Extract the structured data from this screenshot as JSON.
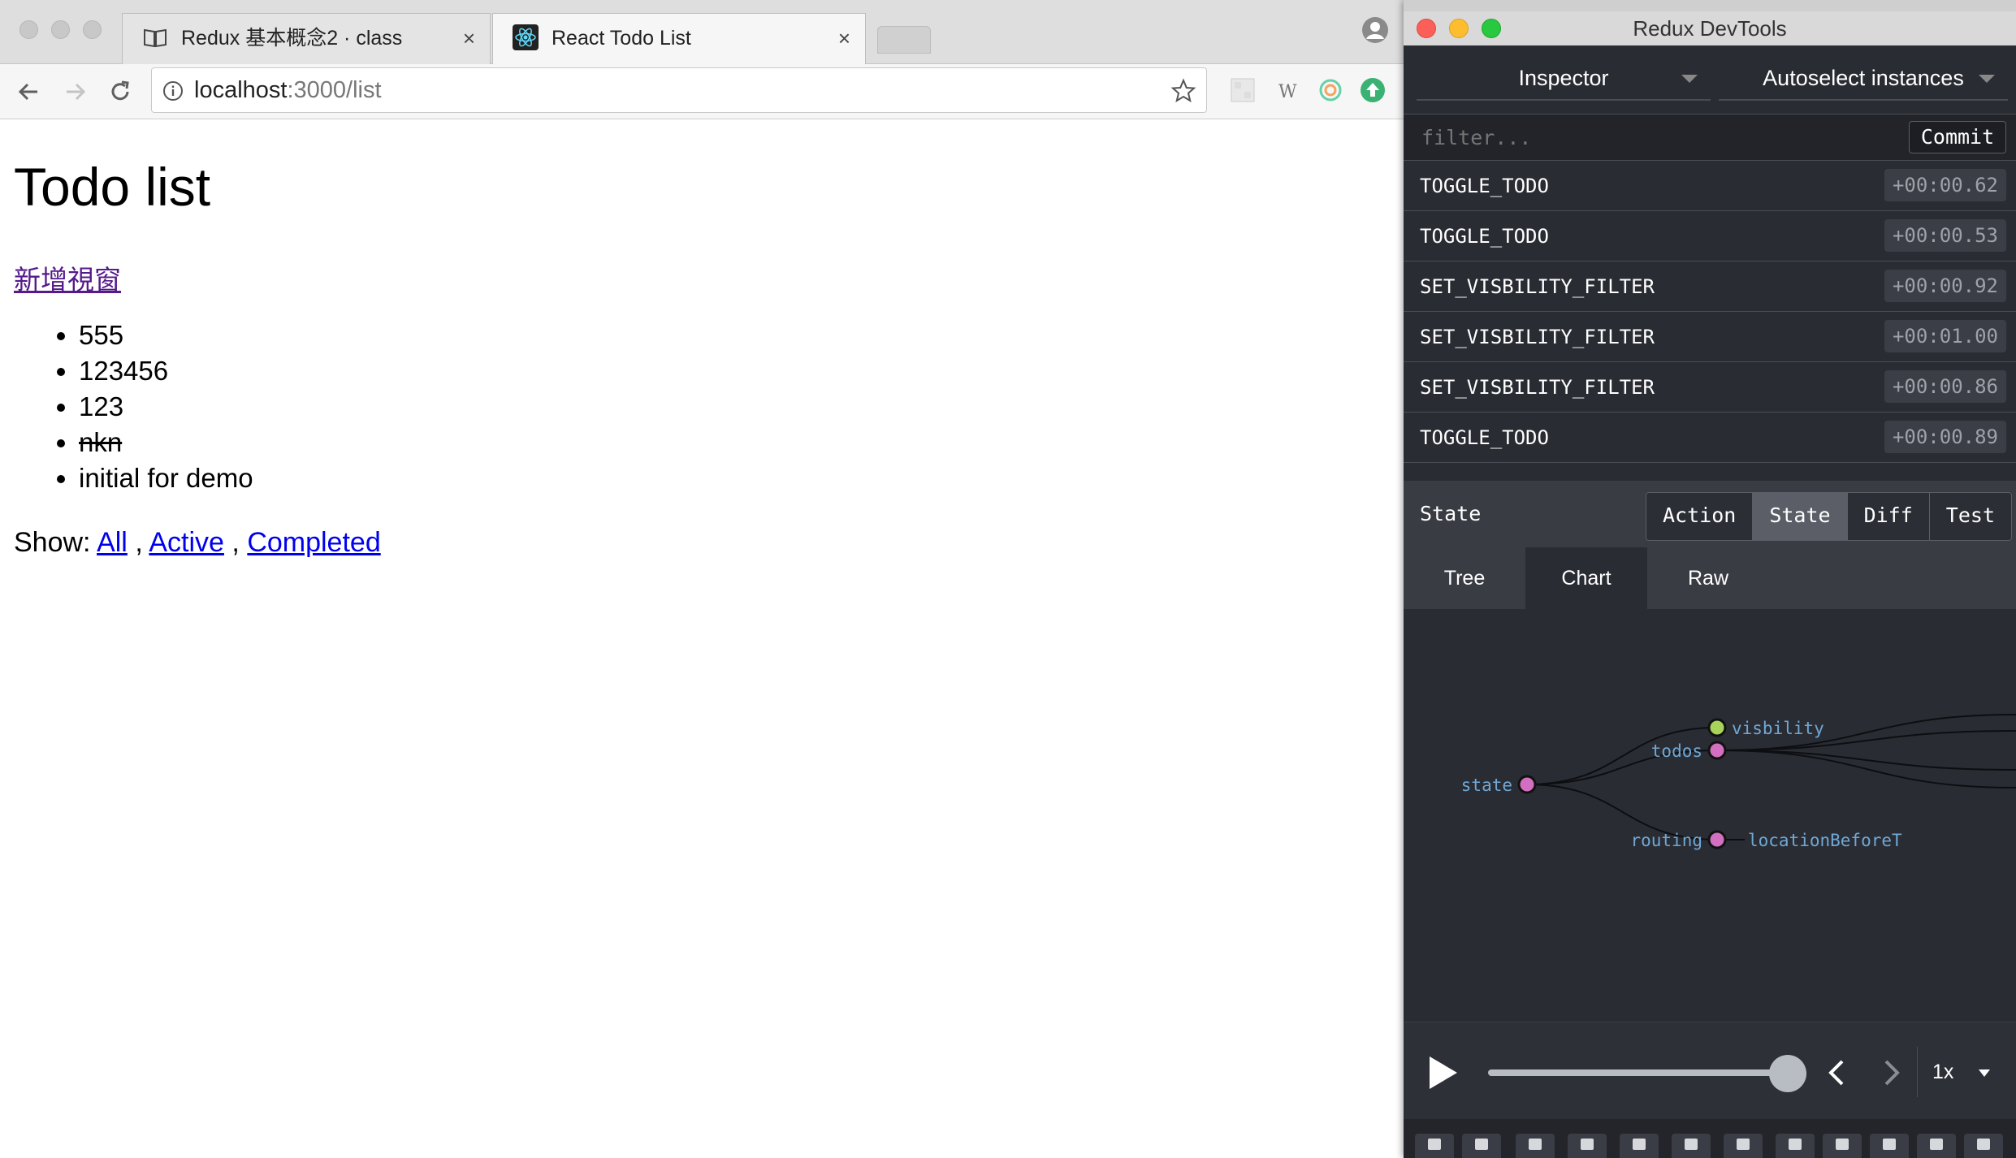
{
  "browser": {
    "tabs": [
      {
        "title": "Redux 基本概念2 · class",
        "close": "×",
        "icon": "book-icon"
      },
      {
        "title": "React Todo List",
        "close": "×",
        "icon": "react-icon"
      }
    ],
    "url": {
      "host": "localhost",
      "path": ":3000/list"
    }
  },
  "page": {
    "heading": "Todo list",
    "new_window_link": "新增視窗",
    "todos": [
      {
        "text": "555",
        "completed": false
      },
      {
        "text": "123456",
        "completed": false
      },
      {
        "text": "123",
        "completed": false
      },
      {
        "text": "nkn",
        "completed": true
      },
      {
        "text": "initial for demo",
        "completed": false
      }
    ],
    "filter": {
      "prefix": "Show:",
      "sep": ",",
      "links": [
        "All",
        "Active",
        "Completed"
      ]
    }
  },
  "devtools": {
    "window_title": "Redux DevTools",
    "monitor_select": "Inspector",
    "instance_select": "Autoselect instances",
    "filter_placeholder": "filter...",
    "commit_label": "Commit",
    "actions": [
      {
        "type": "TOGGLE_TODO",
        "time": "+00:00.62"
      },
      {
        "type": "TOGGLE_TODO",
        "time": "+00:00.53"
      },
      {
        "type": "SET_VISBILITY_FILTER",
        "time": "+00:00.92"
      },
      {
        "type": "SET_VISBILITY_FILTER",
        "time": "+00:01.00"
      },
      {
        "type": "SET_VISBILITY_FILTER",
        "time": "+00:00.86"
      },
      {
        "type": "TOGGLE_TODO",
        "time": "+00:00.89"
      }
    ],
    "state_label": "State",
    "mode_tabs": [
      {
        "label": "Action",
        "selected": false
      },
      {
        "label": "State",
        "selected": true
      },
      {
        "label": "Diff",
        "selected": false
      },
      {
        "label": "Test",
        "selected": false
      }
    ],
    "view_tabs": [
      {
        "label": "Tree",
        "selected": false
      },
      {
        "label": "Chart",
        "selected": true
      },
      {
        "label": "Raw",
        "selected": false
      }
    ],
    "tree": {
      "root": "state",
      "children": [
        "visbility",
        "todos",
        "routing"
      ],
      "routing_child": "locationBeforeT"
    },
    "slider_position": 1.0,
    "speed": "1x"
  },
  "colors": {
    "devtools_bg": "#2a2c33",
    "node_pink": "#d36fc0",
    "node_green": "#a8d35a",
    "tree_label": "#6fa8d6",
    "link_visited": "#551a8b",
    "link": "#0000ee"
  }
}
